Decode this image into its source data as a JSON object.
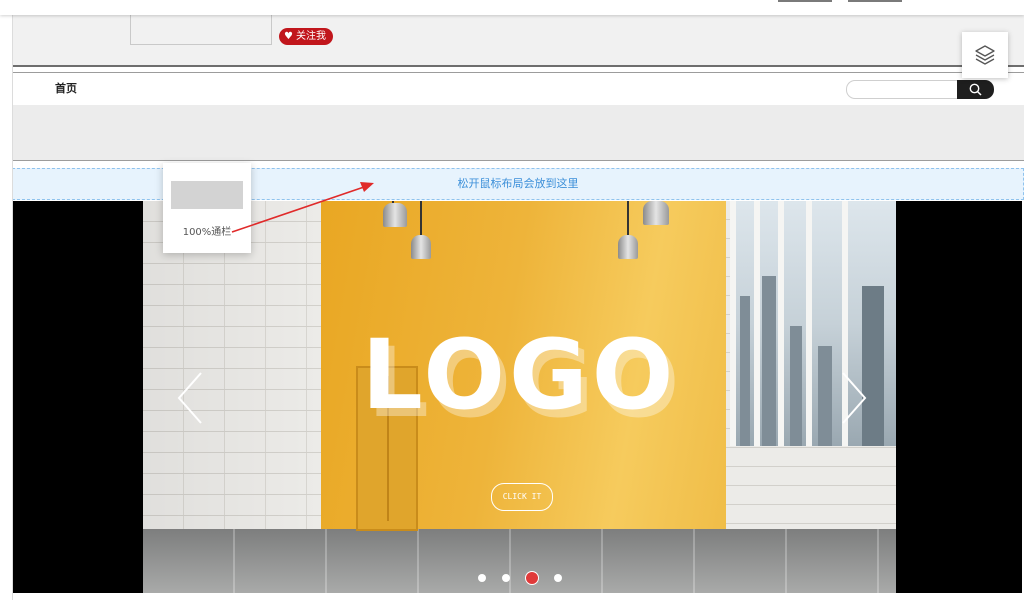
{
  "header": {
    "follow_label": "关注我"
  },
  "nav": {
    "home_label": "首页",
    "search_placeholder": ""
  },
  "editor": {
    "drop_hint": "松开鼠标布局会放到这里",
    "drag_item_label": "100%通栏"
  },
  "banner": {
    "logo_text": "LOGO",
    "cta_label": "CLICK IT",
    "slide_count": 4,
    "active_slide": 3
  },
  "colors": {
    "accent_red": "#c1161c",
    "drop_zone_bg": "#e7f3fd",
    "drop_zone_text": "#3b8fd9",
    "dot_active": "#e03a3a"
  },
  "icons": {
    "follow": "heart-icon",
    "search": "search-icon",
    "layers": "layers-icon",
    "prev": "chevron-left-icon",
    "next": "chevron-right-icon"
  }
}
